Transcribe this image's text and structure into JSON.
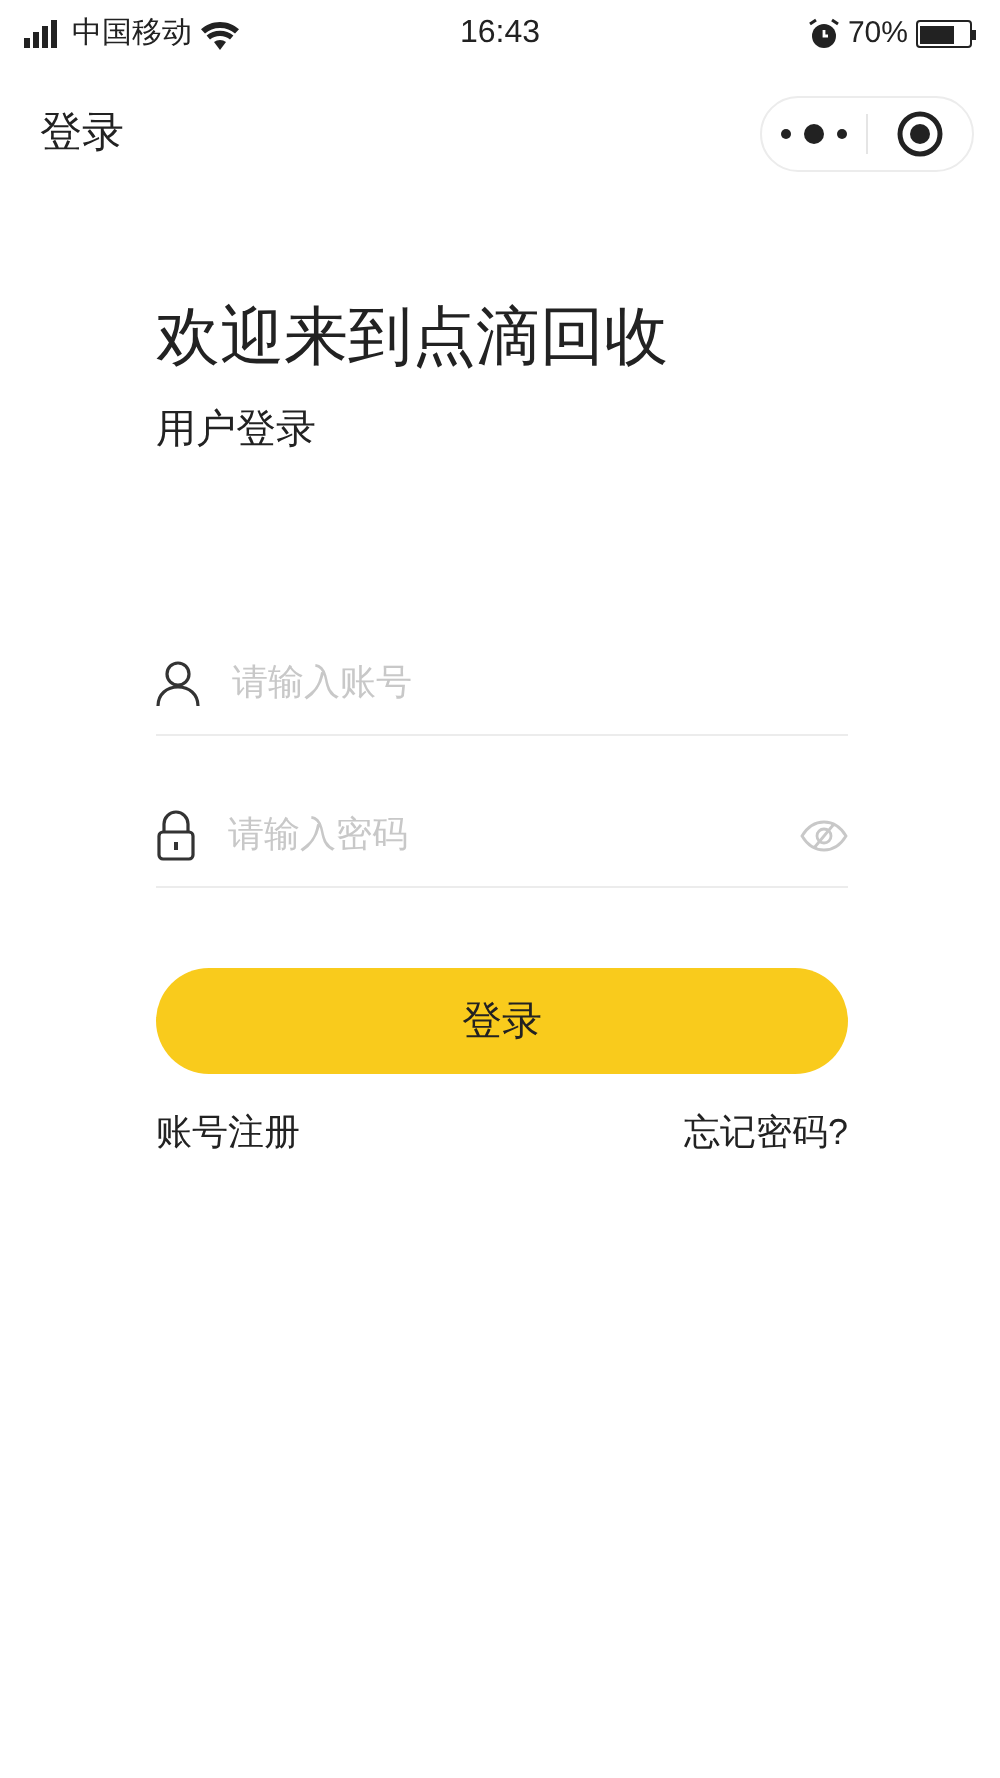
{
  "status_bar": {
    "carrier": "中国移动",
    "time": "16:43",
    "battery": "70%"
  },
  "nav": {
    "title": "登录"
  },
  "heading": "欢迎来到点滴回收",
  "subtitle": "用户登录",
  "fields": [
    {
      "kind": "user",
      "placeholder": "请输入账号"
    },
    {
      "kind": "password",
      "placeholder": "请输入密码"
    }
  ],
  "login_button": "登录",
  "links": [
    "账号注册",
    "忘记密码?"
  ]
}
